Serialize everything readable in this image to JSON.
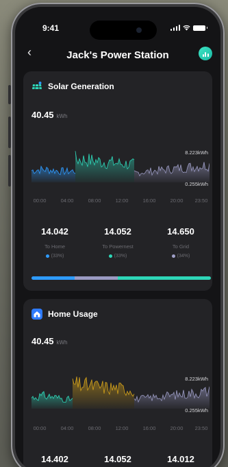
{
  "status": {
    "time": "9:41"
  },
  "nav": {
    "title": "Jack's Power Station"
  },
  "solar": {
    "label": "Solar Generation",
    "total": "40.45",
    "unit": "kWh",
    "max_label": "8.223kWh",
    "min_label": "0.255kWh",
    "ticks": [
      "00:00",
      "04:00",
      "08:00",
      "12:00",
      "16:00",
      "20:00",
      "23:50"
    ],
    "stats": [
      {
        "value": "14.042",
        "name": "To Home",
        "pct": "(33%)",
        "color": "#2e9bff"
      },
      {
        "value": "14.052",
        "name": "To Powernest",
        "pct": "(33%)",
        "color": "#2ed6b8"
      },
      {
        "value": "14.650",
        "name": "To Grid",
        "pct": "(34%)",
        "color": "#a0a0c8"
      }
    ],
    "shares": [
      0.24,
      0.24,
      0.52
    ],
    "colors": [
      "#2e9bff",
      "#9a9ac2",
      "#2ed6b8"
    ]
  },
  "home": {
    "label": "Home Usage",
    "total": "40.45",
    "unit": "kWh",
    "max_label": "8.223kWh",
    "min_label": "0.255kWh",
    "ticks": [
      "00:00",
      "04:00",
      "08:00",
      "12:00",
      "16:00",
      "20:00",
      "23:50"
    ],
    "stats": [
      {
        "value": "14.402"
      },
      {
        "value": "14.052"
      },
      {
        "value": "14.012"
      }
    ]
  }
}
